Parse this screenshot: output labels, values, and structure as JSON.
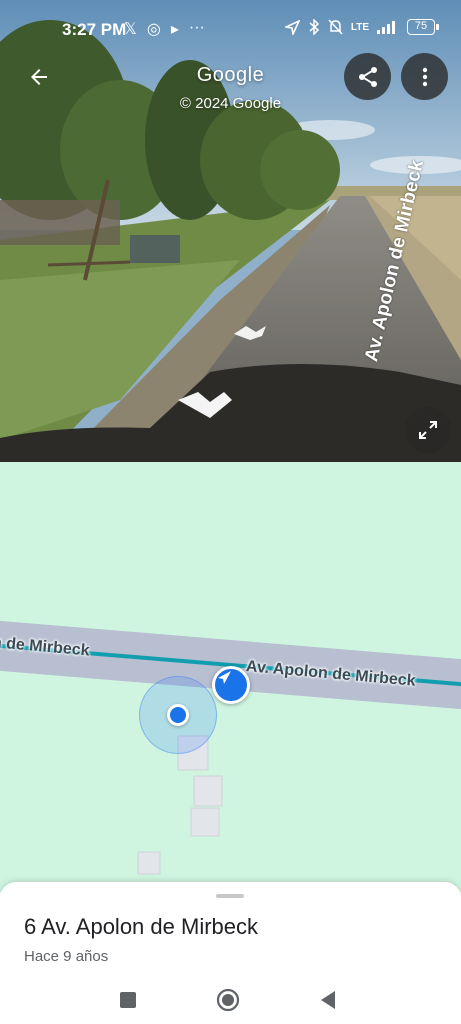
{
  "status_bar": {
    "time": "3:27 PM",
    "app_icons": [
      "x-icon",
      "instagram-icon",
      "play-icon",
      "more-dots"
    ],
    "app_glyphs": [
      "𝕏",
      "◎",
      "▸",
      "···"
    ],
    "system_icons": [
      "location-icon",
      "bluetooth-icon",
      "mute-icon",
      "signal-icon"
    ],
    "network": "LTE",
    "battery": "75"
  },
  "streetview": {
    "brand": "Google",
    "copyright": "© 2024 Google",
    "road_label": "Av. Apolon de Mirbeck",
    "buttons": {
      "back": "back-arrow-icon",
      "share": "share-icon",
      "more": "more-vert-icon",
      "expand": "expand-icon"
    }
  },
  "map": {
    "street_label_left": "n de Mirbeck",
    "street_label_right": "Av. Apolon de Mirbeck",
    "colors": {
      "land": "#cff5e0",
      "road": "#b6bfd0",
      "route": "#129eaf",
      "marker": "#1a73e8"
    }
  },
  "place": {
    "title": "6 Av. Apolon de Mirbeck",
    "subtitle": "Hace 9 años"
  },
  "system_nav": [
    "recents-icon",
    "home-icon",
    "back-icon"
  ]
}
